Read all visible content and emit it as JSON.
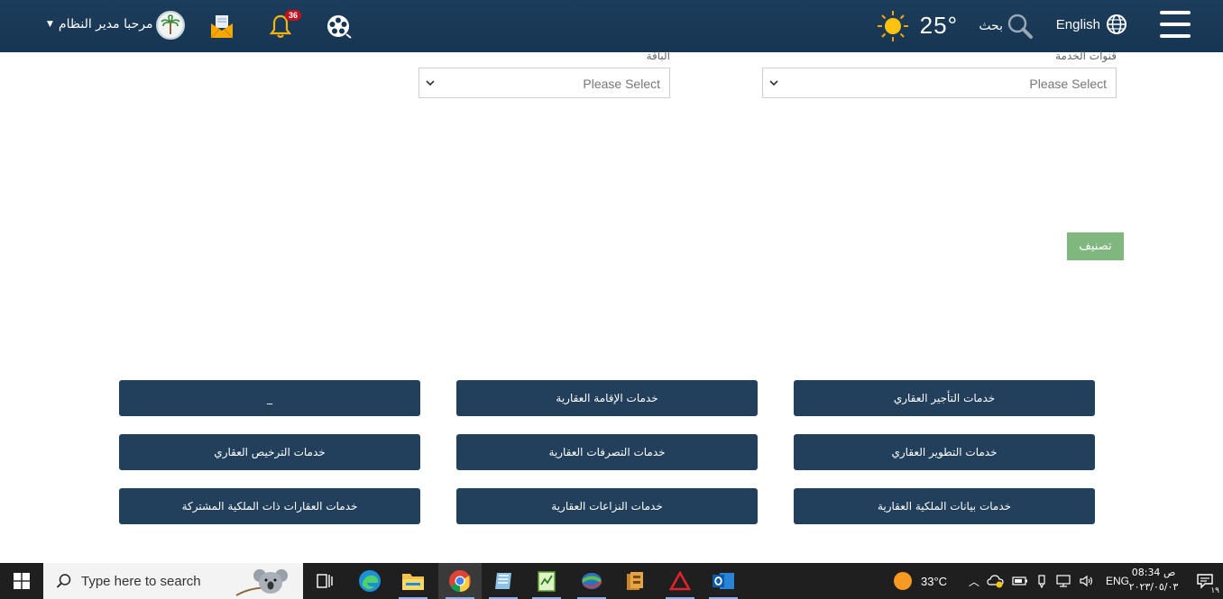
{
  "header": {
    "welcome_text": "مرحبا مدير النظام",
    "badge_count": "36",
    "temperature": "25°",
    "search_label": "بحث",
    "language_label": "English"
  },
  "form": {
    "service_channels_label": "قنوات الخدمة",
    "service_channels_placeholder": "Please Select",
    "package_label": "الباقة",
    "package_placeholder": "Please Select",
    "classify_button": "تصنيف"
  },
  "services": {
    "items": [
      {
        "label": "خدمات التأجير العقاري"
      },
      {
        "label": "خدمات الإقامة العقارية"
      },
      {
        "label": "_"
      },
      {
        "label": "خدمات التطوير العقاري"
      },
      {
        "label": "خدمات التصرفات العقارية"
      },
      {
        "label": "خدمات الترخيص العقاري"
      },
      {
        "label": "خدمات بيانات الملكية العقارية"
      },
      {
        "label": "خدمات النزاعات العقارية"
      },
      {
        "label": "خدمات العقارات ذات الملكية المشتركة"
      }
    ]
  },
  "taskbar": {
    "search_placeholder": "Type here to search",
    "weather_temp": "33°C",
    "language": "ENG",
    "time": "08:34 ص",
    "date": "٢٠٢٣/٠٥/٠٣",
    "notification_count": "١٩"
  },
  "colors": {
    "header_bg": "#1c3d5b",
    "service_button_bg": "#223f5c",
    "classify_button_bg": "#7fb77e",
    "badge_bg": "#c1121f"
  }
}
